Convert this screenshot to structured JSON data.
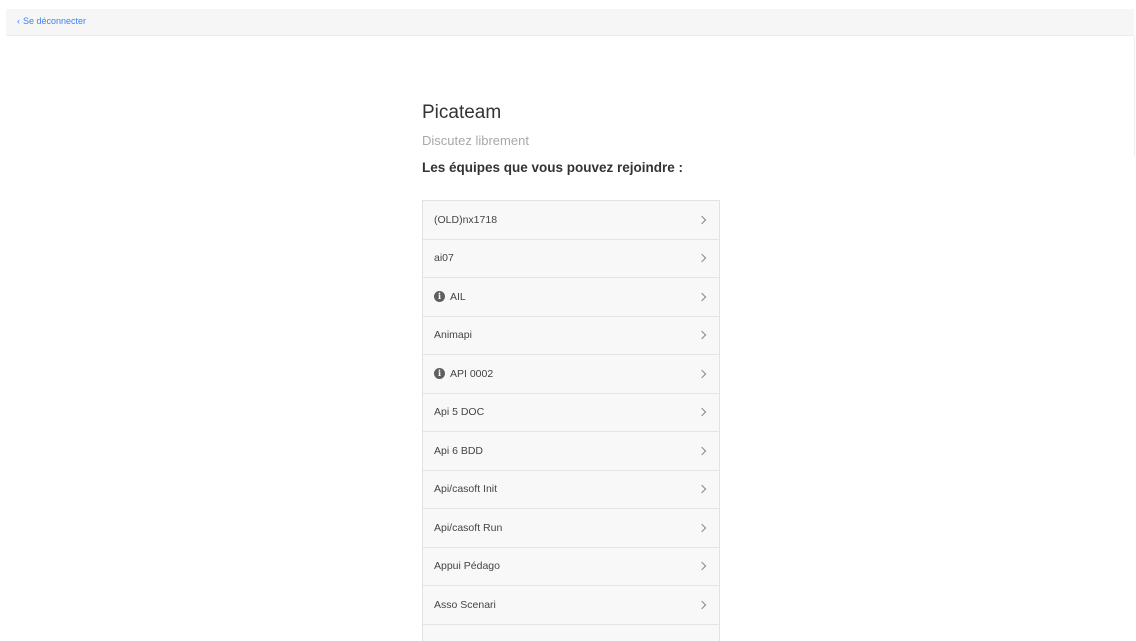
{
  "topbar": {
    "logout_label": "Se déconnecter",
    "chevron_glyph": "‹"
  },
  "app": {
    "title": "Picateam",
    "subtitle": "Discutez librement"
  },
  "teams_heading": "Les équipes que vous pouvez rejoindre :",
  "teams": [
    {
      "name": "(OLD)nx1718",
      "info_icon": false
    },
    {
      "name": "ai07",
      "info_icon": false
    },
    {
      "name": "AIL",
      "info_icon": true
    },
    {
      "name": "Animapi",
      "info_icon": false
    },
    {
      "name": "API 0002",
      "info_icon": true
    },
    {
      "name": "Api 5 DOC",
      "info_icon": false
    },
    {
      "name": "Api 6 BDD",
      "info_icon": false
    },
    {
      "name": "Api/casoft Init",
      "info_icon": false
    },
    {
      "name": "Api/casoft Run",
      "info_icon": false
    },
    {
      "name": "Appui Pédago",
      "info_icon": false
    },
    {
      "name": "Asso Scenari",
      "info_icon": false
    },
    {
      "name": "",
      "info_icon": false
    }
  ],
  "icons": {
    "info": "info-circle-icon",
    "chevron": "chevron-right-icon",
    "back": "chevron-left-icon"
  },
  "colors": {
    "link": "#3b82f6",
    "topbar_bg": "#f6f6f6",
    "row_bg": "#f8f8f8",
    "info_icon": "#5f5f5f"
  }
}
